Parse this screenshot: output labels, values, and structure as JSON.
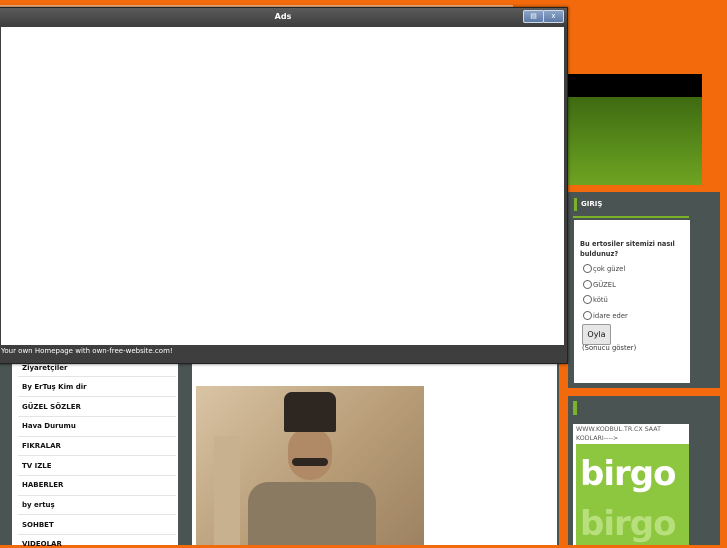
{
  "ads_window": {
    "title": "Ads",
    "footer_text": "Your own Homepage with own-free-website.com!",
    "btn_minimize": "▤",
    "btn_close": "x"
  },
  "login_box": {
    "title": "GIRIŞ",
    "poll_question": "Bu ertosiler sitemizi nasıl buldunuz?",
    "options": [
      "çok güzel",
      "GÜZEL",
      "kötü",
      "idare eder"
    ],
    "vote_label": "Oyla",
    "results_label": "(Sonucu göster)"
  },
  "clock_box": {
    "text": "WWW.KODBUL.TR.CX SAAT KODLARI---->",
    "logo_text": "birgo"
  },
  "menu": {
    "items": [
      "Ziyaretçiler",
      "By ErTuş Kim dir",
      "GÜZEL SÖZLER",
      "Hava Durumu",
      "FIKRALAR",
      "TV IZLE",
      "HABERLER",
      "by ertuş",
      "SOHBET",
      "VIDEOLAR"
    ]
  },
  "colors": {
    "accent": "#f26a0c",
    "frame": "#4a5452",
    "green": "#7ab22a"
  }
}
